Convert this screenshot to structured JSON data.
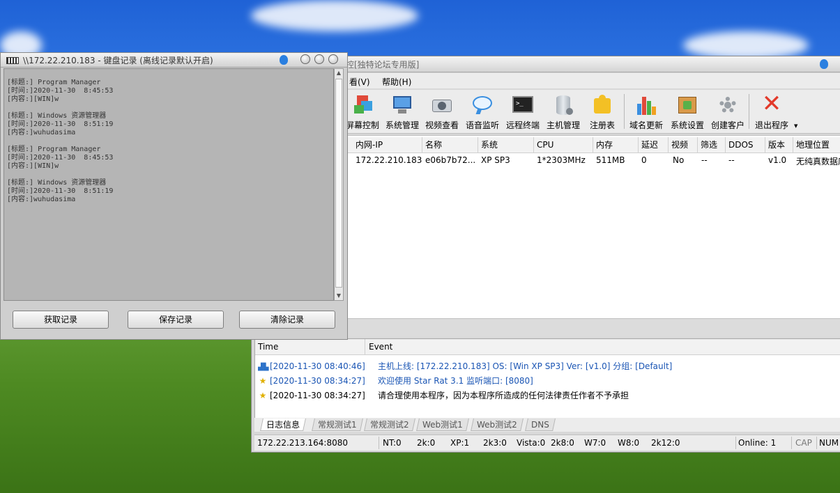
{
  "main_window": {
    "title": "控[独特论坛专用版]",
    "menu": [
      "看(V)",
      "帮助(H)"
    ],
    "toolbar": [
      {
        "label": "屏幕控制",
        "icon": "screen-control-icon"
      },
      {
        "label": "系统管理",
        "icon": "system-manage-icon"
      },
      {
        "label": "视频查看",
        "icon": "camera-icon"
      },
      {
        "label": "语音监听",
        "icon": "speech-bubble-icon"
      },
      {
        "label": "远程终端",
        "icon": "terminal-icon"
      },
      {
        "label": "主机管理",
        "icon": "database-icon"
      },
      {
        "label": "注册表",
        "icon": "puzzle-icon"
      },
      {
        "label": "域名更新",
        "icon": "bar-chart-icon"
      },
      {
        "label": "系统设置",
        "icon": "box-download-icon"
      },
      {
        "label": "创建客户",
        "icon": "gear-icon"
      },
      {
        "label": "退出程序",
        "icon": "close-x-icon"
      }
    ],
    "grid": {
      "columns": [
        "内网-IP",
        "名称",
        "系统",
        "CPU",
        "内存",
        "延迟",
        "视频",
        "筛选",
        "DDOS",
        "版本",
        "地理位置"
      ],
      "rows": [
        [
          "172.22.210.183",
          "e06b7b72...",
          "XP SP3",
          "1*2303MHz",
          "511MB",
          "0",
          "No",
          "--",
          "--",
          "v1.0",
          "无纯真数据库"
        ]
      ]
    },
    "log": {
      "columns": [
        "Time",
        "Event"
      ],
      "rows": [
        {
          "icon": "network-icon",
          "time": "[2020-11-30 08:40:46]",
          "event": "主机上线: [172.22.210.183]   OS: [Win XP SP3]   Ver: [v1.0]   分组: [Default]",
          "color": "#1a55b4"
        },
        {
          "icon": "star-icon",
          "time": "[2020-11-30 08:34:27]",
          "event": "欢迎使用 Star Rat 3.1   监听端口: [8080]",
          "color": "#1a55b4"
        },
        {
          "icon": "star-icon",
          "time": "[2020-11-30 08:34:27]",
          "event": "请合理使用本程序，因为本程序所造成的任何法律责任作者不予承担",
          "color": "#000000"
        }
      ]
    },
    "tabs": [
      "日志信息",
      "常规测试1",
      "常规测试2",
      "Web测试1",
      "Web测试2",
      "DNS"
    ],
    "status": {
      "address": "172.22.213.164:8080",
      "nt": "NT:0",
      "k2k": "2k:0",
      "xp": "XP:1",
      "k2k3": "2k3:0",
      "vista": "Vista:0",
      "k2k8": "2k8:0",
      "w7": "W7:0",
      "w8": "W8:0",
      "k2k12": "2k12:0",
      "online": "Online: 1",
      "cap": "CAP",
      "num": "NUM"
    }
  },
  "keylog_window": {
    "title": "\\\\172.22.210.183 - 键盘记录 (离线记录默认开启)",
    "entries": [
      {
        "title": "[标题:] Program Manager",
        "time": "[时间:]2020-11-30  8:45:53",
        "content": "[内容:][WIN]w"
      },
      {
        "title": "[标题:] Windows 资源管理器",
        "time": "[时间:]2020-11-30  8:51:19",
        "content": "[内容:]wuhudasima"
      },
      {
        "title": "[标题:] Program Manager",
        "time": "[时间:]2020-11-30  8:45:53",
        "content": "[内容:][WIN]w"
      },
      {
        "title": "[标题:] Windows 资源管理器",
        "time": "[时间:]2020-11-30  8:51:19",
        "content": "[内容:]wuhudasima"
      }
    ],
    "buttons": {
      "get": "获取记录",
      "save": "保存记录",
      "clear": "清除记录"
    }
  }
}
